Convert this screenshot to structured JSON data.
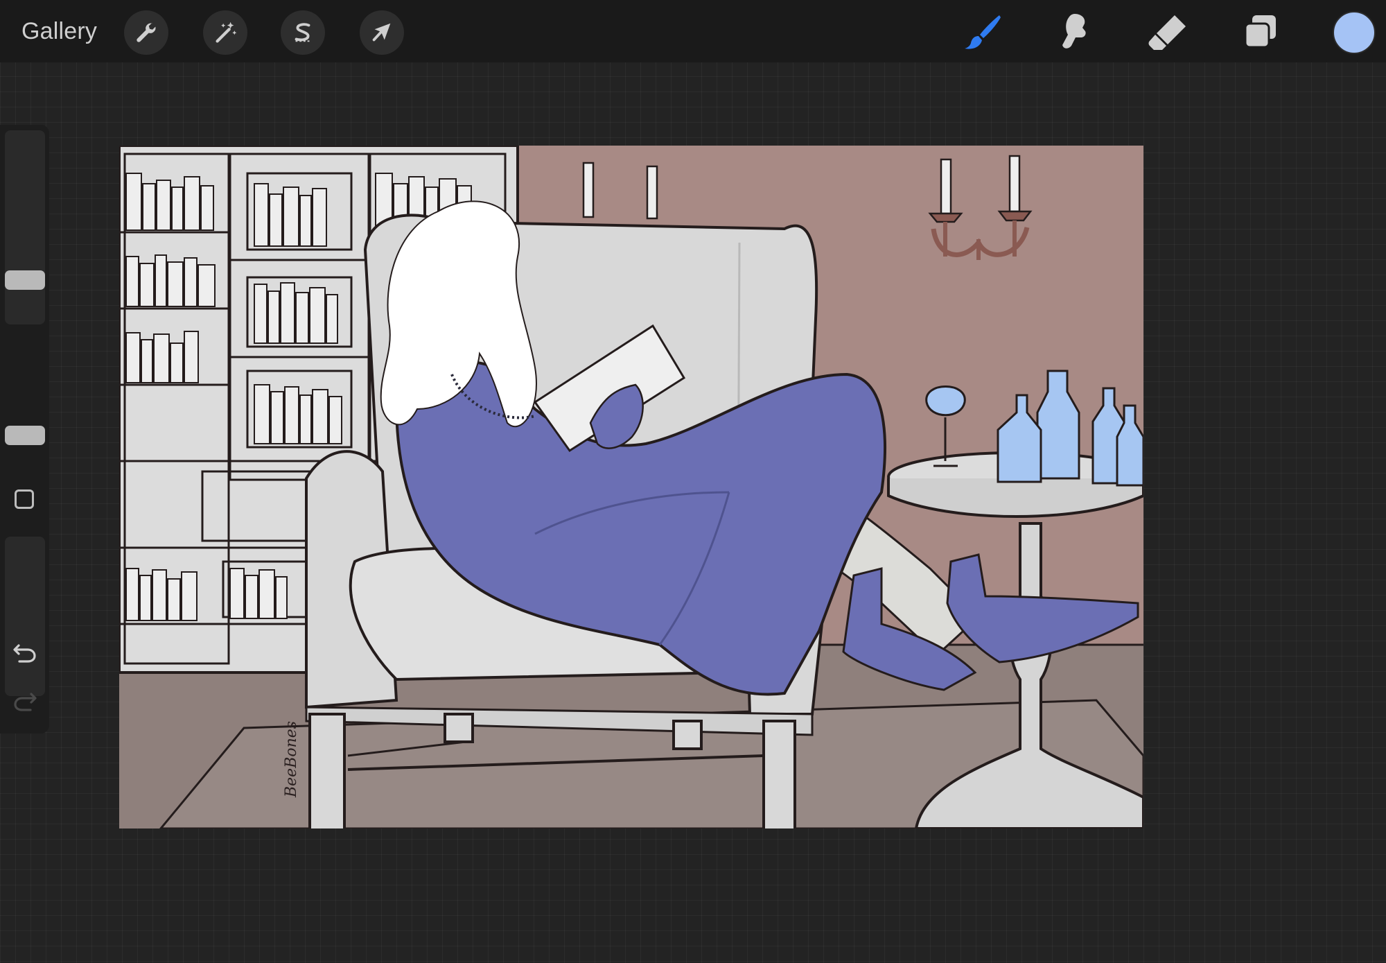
{
  "app": {
    "gallery_label": "Gallery"
  },
  "toolbar": {
    "left_tools": [
      {
        "icon": "wrench-icon",
        "name": "actions"
      },
      {
        "icon": "magic-wand-icon",
        "name": "adjustments"
      },
      {
        "icon": "selection-s-icon",
        "name": "selection"
      },
      {
        "icon": "arrow-cursor-icon",
        "name": "transform"
      }
    ],
    "right_tools": [
      {
        "icon": "brush-icon",
        "name": "paint",
        "active": true
      },
      {
        "icon": "smudge-icon",
        "name": "smudge"
      },
      {
        "icon": "eraser-icon",
        "name": "eraser"
      },
      {
        "icon": "layers-icon",
        "name": "layers"
      }
    ],
    "current_color": "#a5c3f5"
  },
  "sidebar": {
    "brush_size_level": 0.76,
    "opacity_level": 0.5,
    "icons": [
      "square-modifier-icon",
      "undo-icon",
      "redo-icon"
    ]
  },
  "artwork": {
    "signature": "BeeBones",
    "colors": {
      "wall": "#a88a85",
      "floor": "#8f807c",
      "robe": "#6b6fb4",
      "hair": "#ffffff",
      "chair": "#d8d8d8",
      "glass": "#a6c6f2",
      "outline": "#241c1c"
    }
  }
}
